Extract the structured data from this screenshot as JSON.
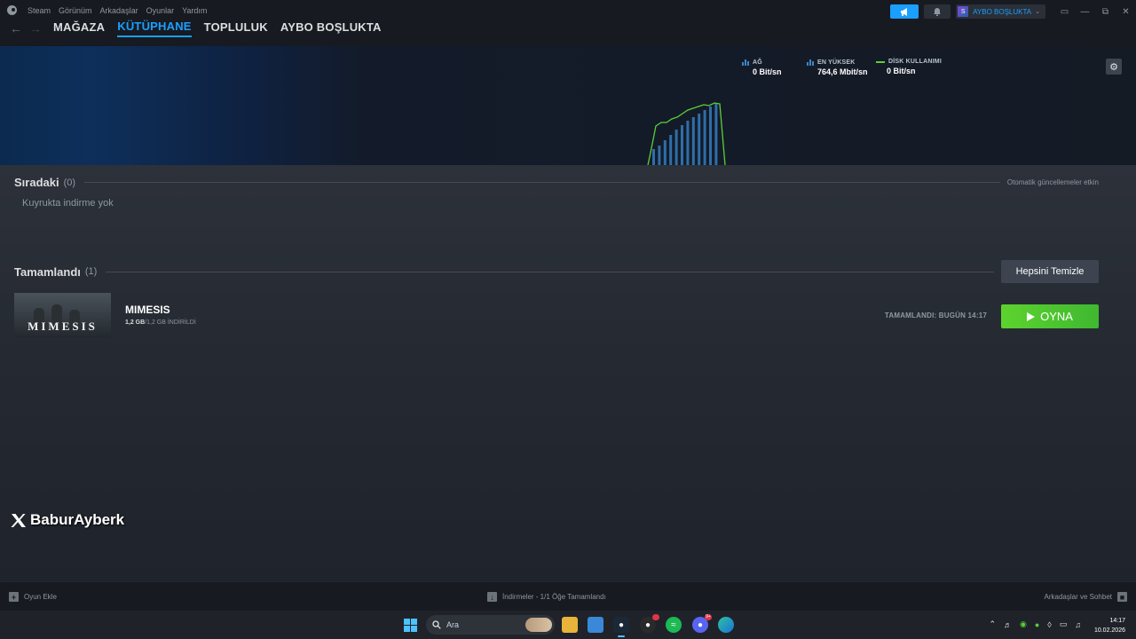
{
  "menu": {
    "items": [
      "Steam",
      "Görünüm",
      "Arkadaşlar",
      "Oyunlar",
      "Yardım"
    ]
  },
  "nav": {
    "links": [
      {
        "label": "MAĞAZA",
        "active": false
      },
      {
        "label": "KÜTÜPHANE",
        "active": true
      },
      {
        "label": "TOPLULUK",
        "active": false
      },
      {
        "label": "AYBO BOŞLUKTA",
        "active": false
      }
    ]
  },
  "user": {
    "name": "AYBO BOŞLUKTA",
    "avatar_letter": "S"
  },
  "stats": {
    "network": {
      "label": "AĞ",
      "value": "0 Bit/sn"
    },
    "peak": {
      "label": "EN YÜKSEK",
      "value": "764,6 Mbit/sn"
    },
    "disk": {
      "label": "DİSK KULLANIMI",
      "value": "0 Bit/sn"
    }
  },
  "chart_data": {
    "type": "bar",
    "title": "",
    "series": [
      {
        "name": "AĞ",
        "values": [
          18,
          22,
          28,
          34,
          40,
          45,
          50,
          54,
          58,
          62,
          66,
          70
        ]
      }
    ],
    "line_series": [
      {
        "name": "DİSK KULLANIMI",
        "values": [
          14,
          44,
          48,
          48,
          52,
          54,
          58,
          62,
          64,
          66,
          68,
          67,
          70,
          69,
          0
        ]
      }
    ],
    "colors": {
      "bars": "#2f6ea8",
      "line": "#5ccf3a"
    }
  },
  "queue": {
    "title": "Sıradaki",
    "count": "(0)",
    "auto_update": "Otomatik güncellemeler etkin",
    "empty_message": "Kuyrukta indirme yok"
  },
  "completed": {
    "title": "Tamamlandı",
    "count": "(1)",
    "clear_label": "Hepsini Temizle",
    "items": [
      {
        "name": "MIMESIS",
        "thumb_text": "MIMESIS",
        "size_done": "1,2 GB",
        "size_rest": "/1,2 GB İNDİRİLDİ",
        "completed_text": "TAMAMLANDI: BUGÜN 14:17",
        "play_label": "OYNA"
      }
    ]
  },
  "watermark": {
    "text": "BaburAyberk"
  },
  "bottom": {
    "add_game": "Oyun Ekle",
    "downloads": "İndirmeler - 1/1 Öğe Tamamlandı",
    "friends": "Arkadaşlar ve Sohbet"
  },
  "taskbar": {
    "search_placeholder": "Ara",
    "time": "14:17",
    "date": "10.02.2026",
    "notif_badge": "9+"
  }
}
